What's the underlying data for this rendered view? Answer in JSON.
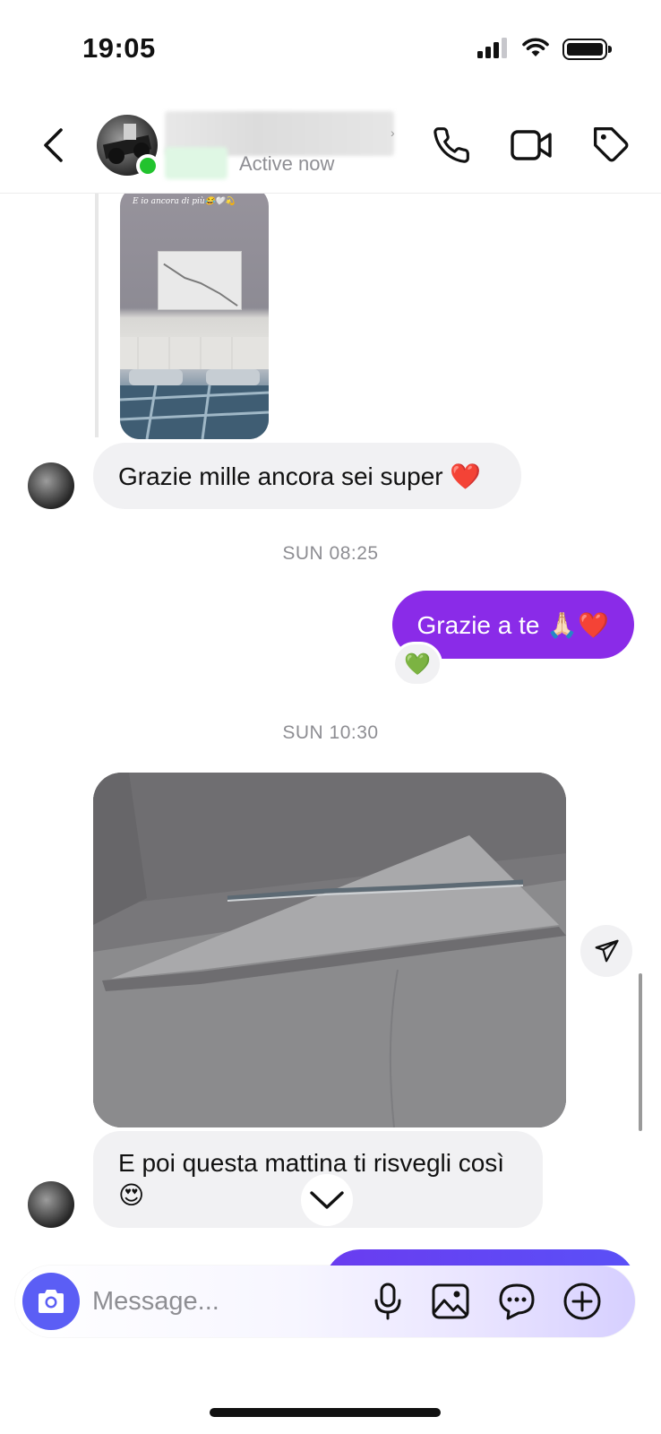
{
  "status_bar": {
    "time": "19:05",
    "icons": [
      "cellular-signal-icon",
      "wifi-icon",
      "battery-icon"
    ]
  },
  "header": {
    "contact_name": "",
    "status": "Active now",
    "online_color": "#22c32e",
    "buttons": [
      "back-icon",
      "phone-icon",
      "video-camera-icon",
      "tag-icon"
    ]
  },
  "messages": {
    "story_caption": "E io ancora di più😂🤍💫",
    "incoming_1": "Grazie mille ancora sei super ❤️",
    "timestamp_1": "SUN 08:25",
    "outgoing_1": "Grazie a te 🙏🏻❤️",
    "reaction_1": "💚",
    "timestamp_2": "SUN 10:30",
    "incoming_2": "E poi questa mattina ti risvegli così 😍"
  },
  "colors": {
    "outgoing_bubble": "#8a2be8",
    "incoming_bubble": "#f1f1f3",
    "camera_button": "#5b5ef5"
  },
  "composer": {
    "placeholder": "Message...",
    "value": "",
    "buttons": [
      "camera-icon",
      "microphone-icon",
      "gallery-icon",
      "sticker-icon",
      "plus-icon"
    ]
  }
}
